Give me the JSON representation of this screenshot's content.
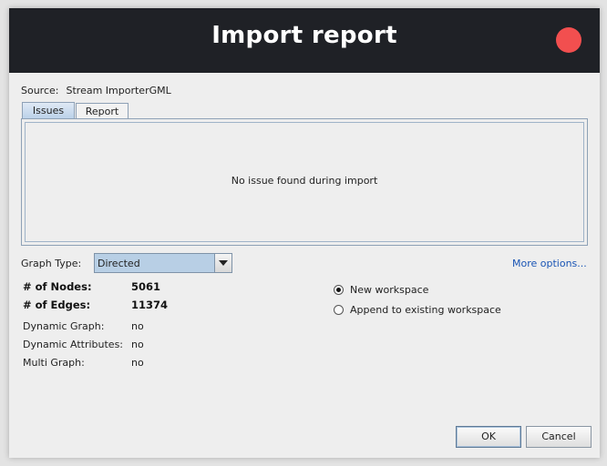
{
  "window": {
    "title": "Import report"
  },
  "source": {
    "label": "Source:",
    "value": "Stream ImporterGML"
  },
  "tabs": [
    {
      "label": "Issues",
      "active": true
    },
    {
      "label": "Report",
      "active": false
    }
  ],
  "issues_panel": {
    "message": "No issue found during import"
  },
  "graph_type": {
    "label": "Graph Type:",
    "selected": "Directed"
  },
  "more_options_label": "More options...",
  "stats": {
    "nodes_label": "# of Nodes:",
    "nodes_value": "5061",
    "edges_label": "# of Edges:",
    "edges_value": "11374",
    "dynamic_graph_label": "Dynamic Graph:",
    "dynamic_graph_value": "no",
    "dynamic_attributes_label": "Dynamic Attributes:",
    "dynamic_attributes_value": "no",
    "multi_graph_label": "Multi Graph:",
    "multi_graph_value": "no"
  },
  "workspace_options": [
    {
      "label": "New workspace",
      "selected": true
    },
    {
      "label": "Append to existing workspace",
      "selected": false
    }
  ],
  "buttons": {
    "ok": "OK",
    "cancel": "Cancel"
  },
  "colors": {
    "titlebar": "#1f2126",
    "close_button": "#f24f4f",
    "link": "#1a55b5",
    "combo_bg": "#b8cfe5"
  },
  "icons": {
    "close": "close-icon",
    "dropdown": "chevron-down-icon"
  }
}
